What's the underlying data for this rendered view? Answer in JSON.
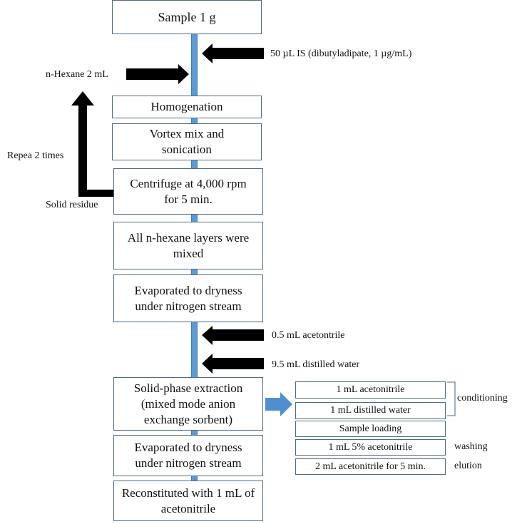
{
  "diagram": {
    "main_steps": [
      {
        "text": "Sample 1 g"
      },
      {
        "text": "Homogenation"
      },
      {
        "text": "Vortex mix and sonication"
      },
      {
        "text": "Centrifuge at 4,000 rpm for 5 min."
      },
      {
        "text": "All n-hexane layers were mixed"
      },
      {
        "text": "Evaporated to dryness under nitrogen stream"
      },
      {
        "text": "Solid-phase extraction (mixed mode anion exchange sorbent)"
      },
      {
        "text": "Evaporated to dryness under nitrogen stream"
      },
      {
        "text": "Reconstituted with 1 mL of acetonitrile"
      }
    ],
    "inputs": {
      "internal_standard": "50 µL IS (dibutyladipate,  1 µg/mL)",
      "hexane": "n-Hexane  2 mL",
      "acetonitrile": "0.5 mL  acetontrile",
      "water": "9.5 mL  distilled  water"
    },
    "loop": {
      "repeat_label": "Repea 2 times",
      "source_label": "Solid  residue"
    },
    "spe_steps": [
      {
        "text": "1 mL  acetonitrile"
      },
      {
        "text": "1 mL  distilled  water"
      },
      {
        "text": "Sample  loading"
      },
      {
        "text": "1 mL  5% acetonitrile"
      },
      {
        "text": "2 mL  acetonitrile  for  5 min."
      }
    ],
    "spe_annotations": {
      "conditioning": "conditioning",
      "washing": "washing",
      "elution": "elution"
    },
    "colors": {
      "spine": "#5b9bd5",
      "box_border": "#4f6a86",
      "arrow": "#000000",
      "spe_arrow": "#4f8fcf"
    }
  }
}
